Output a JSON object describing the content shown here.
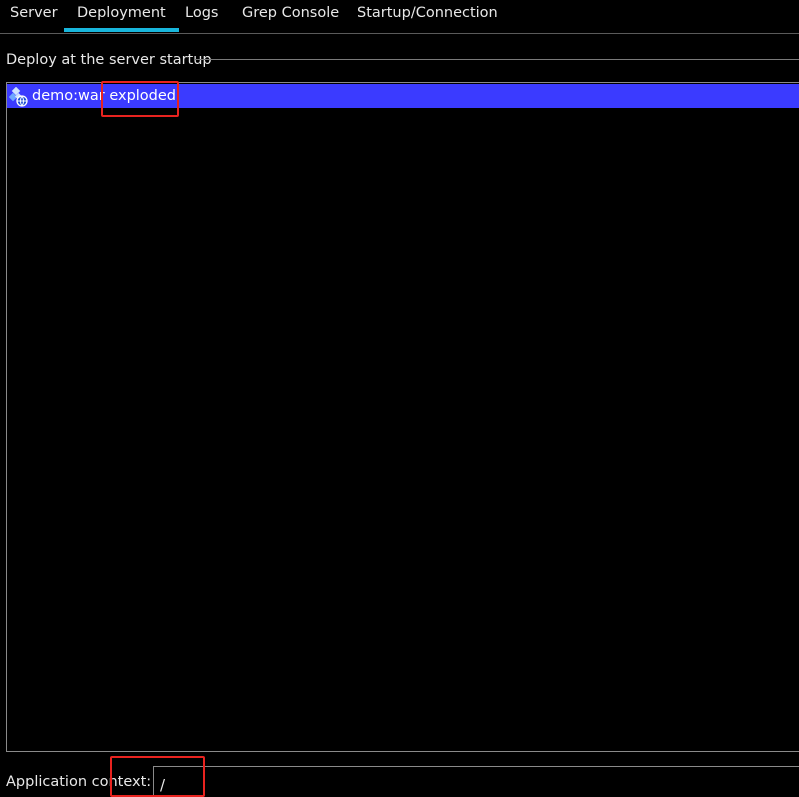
{
  "tabs": [
    {
      "label": "Server"
    },
    {
      "label": "Deployment",
      "active": true
    },
    {
      "label": "Logs"
    },
    {
      "label": "Grep Console"
    },
    {
      "label": "Startup/Connection"
    }
  ],
  "deploy_section": {
    "title": "Deploy at the server startup",
    "items": [
      {
        "label": "demo:war exploded",
        "selected": true,
        "icon": "web-artifact-icon"
      }
    ]
  },
  "context": {
    "label": "Application context:",
    "value": "/"
  },
  "colors": {
    "background": "#000000",
    "text": "#e8e8e8",
    "tab_underline": "#18b6dc",
    "selection": "#3b3bff",
    "annotation": "#e8231f"
  }
}
